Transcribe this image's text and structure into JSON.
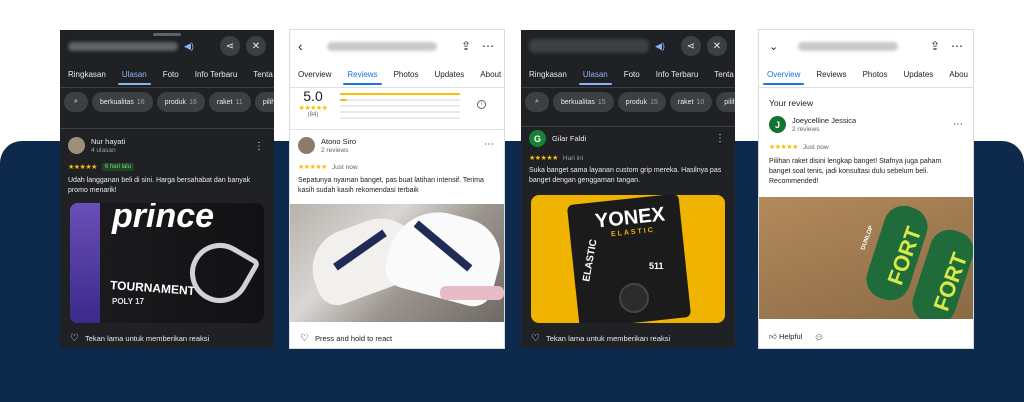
{
  "colors": {
    "background_band": "#0d2a4c",
    "dark_surface": "#202124",
    "accent_dark": "#8ab4f8",
    "accent_light": "#1a73e8",
    "star": "#fbbc04"
  },
  "phone1": {
    "tabs": [
      "Ringkasan",
      "Ulasan",
      "Foto",
      "Info Terbaru",
      "Tenta"
    ],
    "active_tab": 1,
    "chips": [
      {
        "label": "berkualitas",
        "count": "16"
      },
      {
        "label": "produk",
        "count": "16"
      },
      {
        "label": "raket",
        "count": "11"
      },
      {
        "label": "piliha",
        "count": ""
      }
    ],
    "review": {
      "name": "Nur hayati",
      "meta": "4 ulasan",
      "stars": "★★★★★",
      "time": "6 hari lalu",
      "text": "Udah langganan beli di sini. Harga bersahabat dan banyak promo menarik!",
      "photo_brand": "prince",
      "photo_line1": "TOURNAMENT",
      "photo_line2": "POLY 17"
    },
    "footer": "Tekan lama untuk memberikan reaksi"
  },
  "phone2": {
    "tabs": [
      "Overview",
      "Reviews",
      "Photos",
      "Updates",
      "About"
    ],
    "active_tab": 1,
    "rating": "5.0",
    "stars": "★★★★★",
    "count": "(84)",
    "bar_levels": [
      1.0,
      0.06,
      0.0,
      0.0,
      0.0
    ],
    "review": {
      "name": "Atono Siro",
      "meta": "2 reviews",
      "stars": "★★★★★",
      "time": "Just now",
      "text": "Sepatunya nyaman banget, pas buat latihan intensif. Terima kasih sudah kasih rekomendasi terbaik"
    },
    "footer": "Press and hold to react"
  },
  "phone3": {
    "tabs": [
      "Ringkasan",
      "Ulasan",
      "Foto",
      "Info Terbaru",
      "Tenta"
    ],
    "active_tab": 1,
    "chips": [
      {
        "label": "berkualitas",
        "count": "15"
      },
      {
        "label": "produk",
        "count": "15"
      },
      {
        "label": "raket",
        "count": "10"
      },
      {
        "label": "piliha",
        "count": ""
      }
    ],
    "review": {
      "initial": "G",
      "name": "Gilar Faldi",
      "stars": "★★★★★",
      "time": "Hari ini",
      "text": "Suka banget sama layanan custom grip mereka. Hasilnya pas banget dengan genggaman tangan.",
      "photo_brand": "YONEX",
      "photo_sub": "ELASTIC",
      "photo_code": "511"
    },
    "footer": "Tekan lama untuk memberikan reaksi"
  },
  "phone4": {
    "tabs": [
      "Overview",
      "Reviews",
      "Photos",
      "Updates",
      "Abou"
    ],
    "active_tab": 0,
    "section_title": "Your review",
    "review": {
      "initial": "J",
      "name": "Joeycelline Jessica",
      "meta": "2 reviews",
      "stars": "★★★★★",
      "time": "Just now",
      "text": "Pilihan raket disini lengkap banget! Stafnya juga paham banget soal tenis, jadi konsultasi dulu sebelum beli. Recommended!",
      "photo_brand": "DUNLOP",
      "photo_word": "FORT"
    },
    "helpful": "Helpful"
  }
}
